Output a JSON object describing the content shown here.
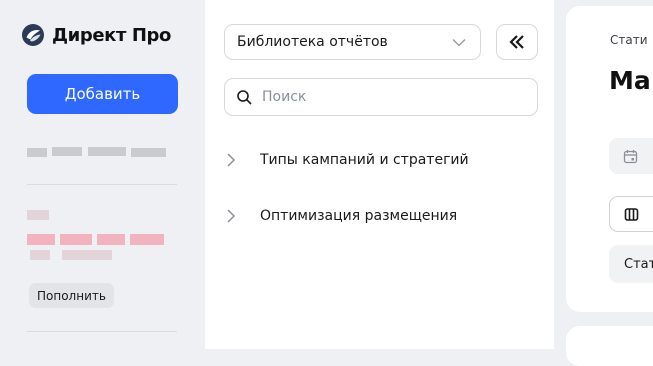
{
  "app": {
    "logo_text": "Директ Про",
    "logo_icon": "yandex-direct-logo-icon",
    "accent_color": "#2e68ff"
  },
  "sidebar": {
    "add_button_label": "Добавить",
    "topup_button_label": "Пополнить"
  },
  "library": {
    "select_value": "Библиотека отчётов",
    "select_icon": "chevron-down-icon",
    "collapse_icon": "double-chevron-left-icon",
    "search_placeholder": "Поиск",
    "search_value": "",
    "search_icon": "search-icon",
    "tree": [
      {
        "label": "Типы кампаний и стратегий",
        "icon": "chevron-right-icon"
      },
      {
        "label": "Оптимизация размещения",
        "icon": "chevron-right-icon"
      }
    ]
  },
  "main": {
    "breadcrumb": "Стати",
    "title": "Ма",
    "date_icon": "calendar-icon",
    "columns_icon": "columns-icon",
    "stat_chip_label": "Стат"
  }
}
